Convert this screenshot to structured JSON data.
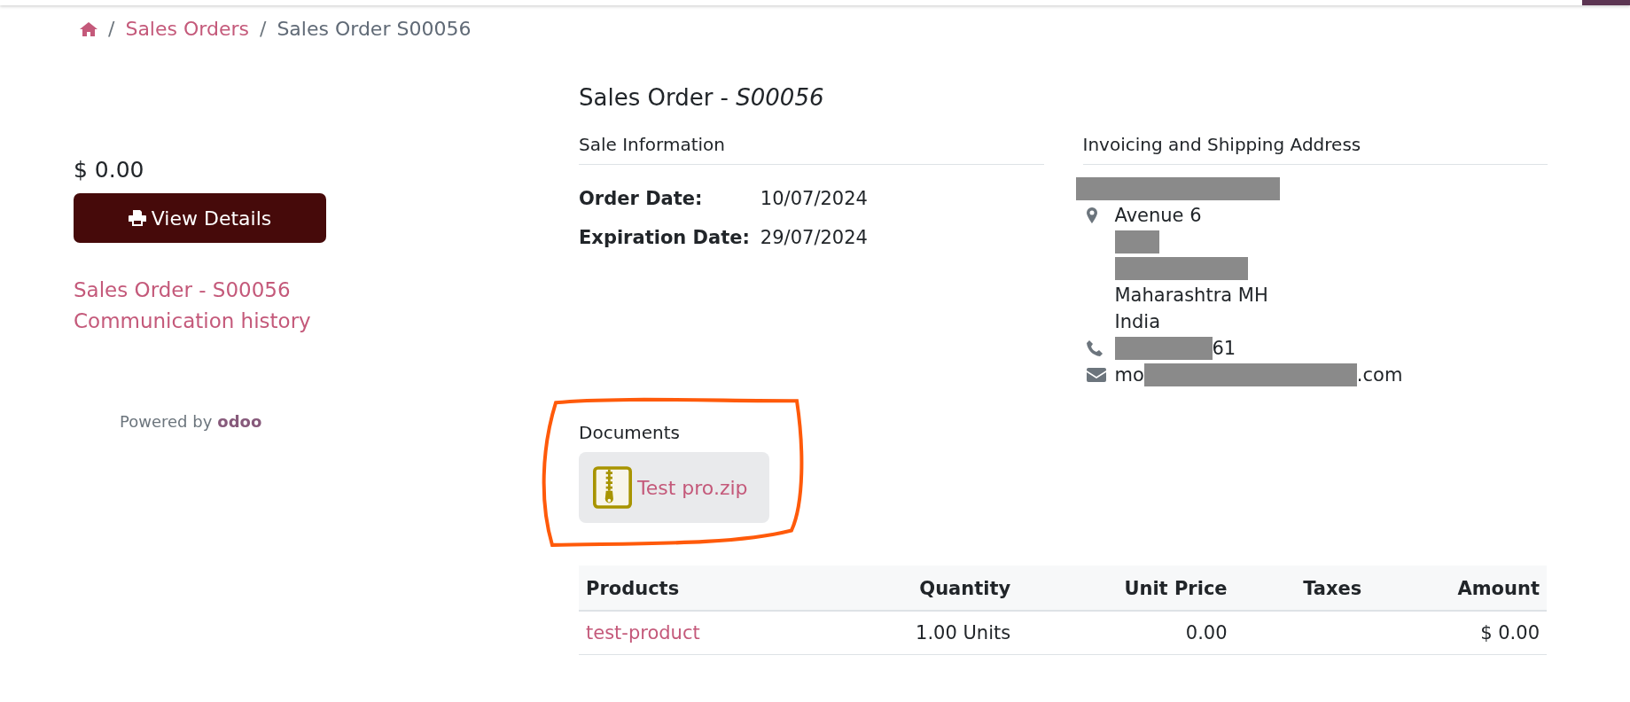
{
  "breadcrumb": [
    {
      "separator": "/",
      "label": "Sales Orders",
      "kind": "link"
    },
    {
      "separator": "/",
      "label": "Sales Order S00056",
      "kind": "current"
    }
  ],
  "sidebar": {
    "amount": "$ 0.00",
    "button": "View Details",
    "links": [
      "Sales Order - S00056",
      "Communication history"
    ],
    "powered_by": "Powered by",
    "brand": "odoo"
  },
  "title": {
    "text": "Sales Order - ",
    "number": "S00056"
  },
  "sale_information": {
    "heading": "Sale Information",
    "fields": [
      {
        "label": "Order Date:",
        "value": "10/07/2024"
      },
      {
        "label": "Expiration Date:",
        "value": "29/07/2024"
      }
    ]
  },
  "address": {
    "heading": "Invoicing and Shipping Address",
    "lines": [
      {
        "kind": "name-redacted"
      },
      {
        "kind": "street",
        "text": "Avenue 6"
      },
      {
        "kind": "redacted"
      },
      {
        "kind": "redacted"
      },
      {
        "kind": "line",
        "text": "Maharashtra MH"
      },
      {
        "kind": "line",
        "text": "India"
      },
      {
        "kind": "phone",
        "suffix": "61"
      },
      {
        "kind": "email",
        "prefix": "mo",
        "suffix": ".com"
      }
    ]
  },
  "documents": {
    "heading": "Documents",
    "files": [
      {
        "name": "Test pro.zip"
      }
    ]
  },
  "table": {
    "columns": [
      "Products",
      "Quantity",
      "Unit Price",
      "Taxes",
      "Amount"
    ],
    "rows": [
      [
        "test-product",
        "1.00 Units",
        "0.00",
        "",
        "$ 0.00"
      ]
    ]
  }
}
